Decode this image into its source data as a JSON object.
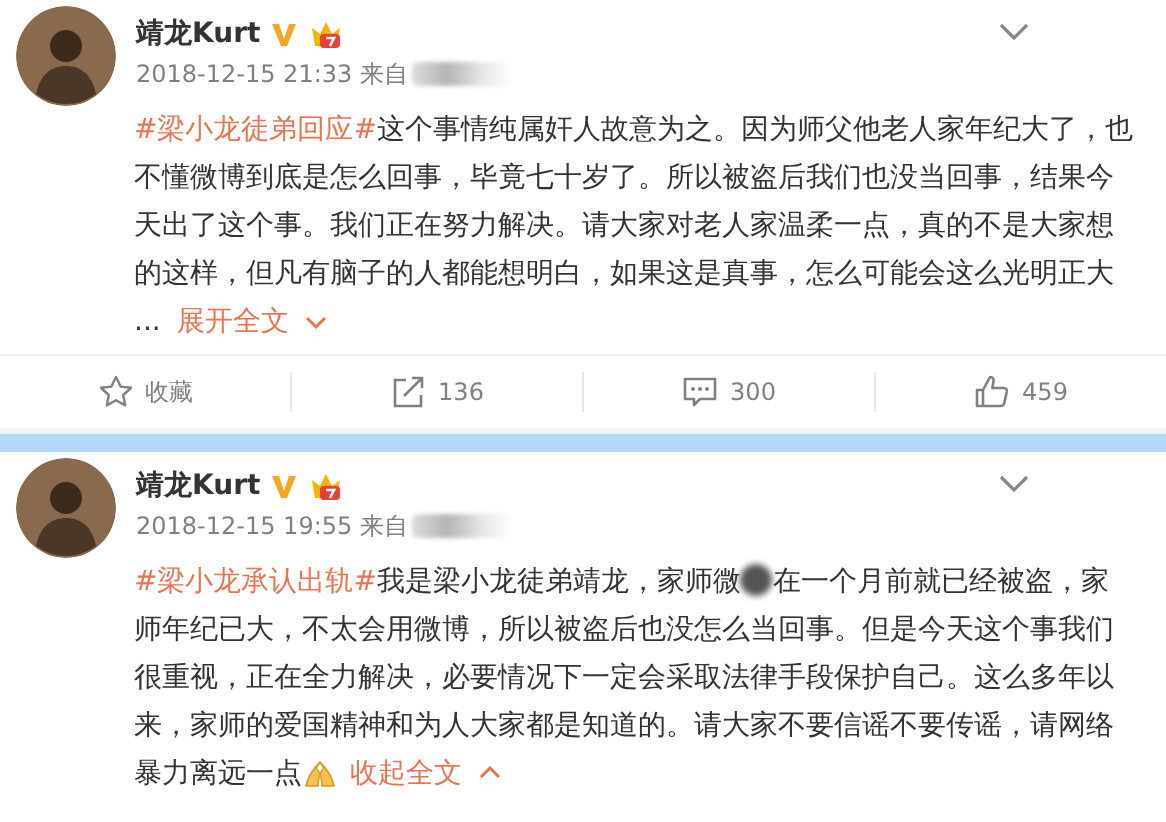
{
  "posts": [
    {
      "author": "靖龙Kurt",
      "time": "2018-12-15 21:33",
      "source": "来自",
      "body": [
        {
          "kind": "hashtag",
          "text": "#梁小龙徒弟回应#"
        },
        {
          "kind": "text",
          "text": "这个事情纯属奸人故意为之。因为师父他老人家年纪大了，也不懂微博到底是怎么回事，毕竟七十岁了。所以被盗后我们也没当回事，结果今天出了这个事。我们正在努力解决。请大家对老人家温柔一点，真的不是大家想的这样，但凡有脑子的人都能想明白，如果这是真事，怎么可能会这么光明正大"
        }
      ],
      "ellipsis": "...",
      "toggle": {
        "label": "展开全文",
        "expanded": false
      },
      "actions": [
        {
          "kind": "favorite",
          "label": "收藏"
        },
        {
          "kind": "repost",
          "label": "136"
        },
        {
          "kind": "comment",
          "label": "300"
        },
        {
          "kind": "like",
          "label": "459"
        }
      ]
    },
    {
      "author": "靖龙Kurt",
      "time": "2018-12-15 19:55",
      "source": "来自",
      "body": [
        {
          "kind": "hashtag",
          "text": "#梁小龙承认出轨#"
        },
        {
          "kind": "text",
          "text": "我是梁小龙徒弟靖龙，家师微"
        },
        {
          "kind": "redaction"
        },
        {
          "kind": "text",
          "text": "在一个月前就已经被盗，家师年纪已大，不太会用微博，所以被盗后也没怎么当回事。但是今天这个事我们很重视，正在全力解决，必要情况下一定会采取法律手段保护自己。这么多年以来，家师的爱国精神和为人大家都是知道的。请大家不要信谣不要传谣，请网络暴力离远一点"
        },
        {
          "kind": "emoji"
        }
      ],
      "toggle": {
        "label": "收起全文",
        "expanded": true
      }
    }
  ]
}
